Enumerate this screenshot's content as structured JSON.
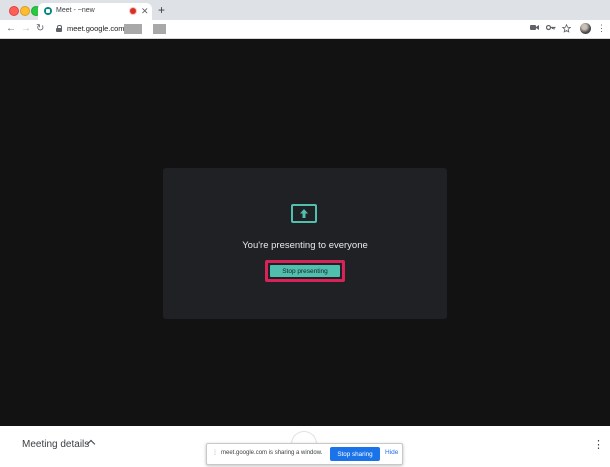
{
  "browser": {
    "tab": {
      "title": "Meet - ~new",
      "favicon_icon": "google-meet-icon",
      "recording_indicator_color": "#d93025",
      "close_label": "✕"
    },
    "new_tab_label": "+",
    "nav": {
      "back": "←",
      "forward": "→",
      "reload": "↻"
    },
    "address": {
      "url": "meet.google.com/"
    },
    "toolbar_icons": [
      "camera-icon",
      "key-icon",
      "star-icon"
    ],
    "menu_label": "⋮"
  },
  "meet": {
    "presenting_text": "You're presenting to everyone",
    "stop_presenting_label": "Stop presenting",
    "accent_color": "#4fbfae",
    "highlight_color": "#d6235a"
  },
  "bottom_bar": {
    "meeting_details_label": "Meeting details",
    "menu_label": "⋮"
  },
  "share_bar": {
    "message": "meet.google.com is sharing a window.",
    "stop_sharing_label": "Stop sharing",
    "hide_label": "Hide",
    "button_color": "#1a73e8"
  }
}
